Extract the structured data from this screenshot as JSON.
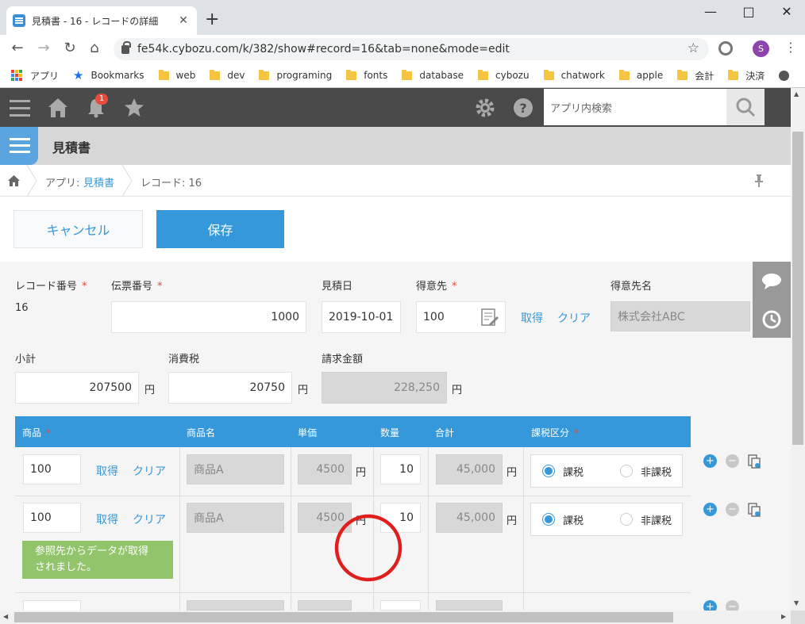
{
  "browser": {
    "tab_title": "見積書 - 16 - レコードの詳細",
    "tab_close": "✕",
    "new_tab": "+",
    "url": "fe54k.cybozu.com/k/382/show#record=16&tab=none&mode=edit",
    "profile_initial": "S",
    "bookmarks": [
      "アプリ",
      "Bookmarks",
      "web",
      "dev",
      "programing",
      "fonts",
      "database",
      "cybozu",
      "chatwork",
      "apple",
      "会計",
      "決済"
    ]
  },
  "kintone": {
    "notification_count": "1",
    "search_placeholder": "アプリ内検索",
    "app_name": "見積書",
    "breadcrumb_app_prefix": "アプリ:",
    "breadcrumb_app_link": "見積書",
    "breadcrumb_record": "レコード: 16",
    "cancel_label": "キャンセル",
    "save_label": "保存"
  },
  "form": {
    "record_no_label": "レコード番号",
    "record_no_value": "16",
    "slip_no_label": "伝票番号",
    "slip_no_value": "1000",
    "date_label": "見積日",
    "date_value": "2019-10-01",
    "customer_label": "得意先",
    "customer_value": "100",
    "get_label": "取得",
    "clear_label": "クリア",
    "customer_name_label": "得意先名",
    "customer_name_value": "株式会社ABC",
    "subtotal_label": "小計",
    "subtotal_value": "207500",
    "tax_label": "消費税",
    "tax_value": "20750",
    "total_label": "請求金額",
    "total_value": "228,250",
    "yen": "円",
    "required_mark": "*"
  },
  "table": {
    "headers": {
      "product": "商品",
      "product_name": "商品名",
      "unit_price": "単価",
      "qty": "数量",
      "sum": "合計",
      "tax_class": "課税区分"
    },
    "rows": [
      {
        "product": "100",
        "product_name": "商品A",
        "unit_price": "4500",
        "qty": "10",
        "sum": "45,000",
        "taxable": "課税",
        "non_taxable": "非課税"
      },
      {
        "product": "100",
        "product_name": "商品A",
        "unit_price": "4500",
        "qty": "10",
        "sum": "45,000",
        "taxable": "課税",
        "non_taxable": "非課税"
      }
    ],
    "tooltip_line1": "参照先からデータが取得",
    "tooltip_line2": "されました。"
  },
  "colors": {
    "accent": "#3498db",
    "header_dark": "#4a4a4a",
    "success": "#91c46b",
    "annotation": "#e01e1e"
  }
}
